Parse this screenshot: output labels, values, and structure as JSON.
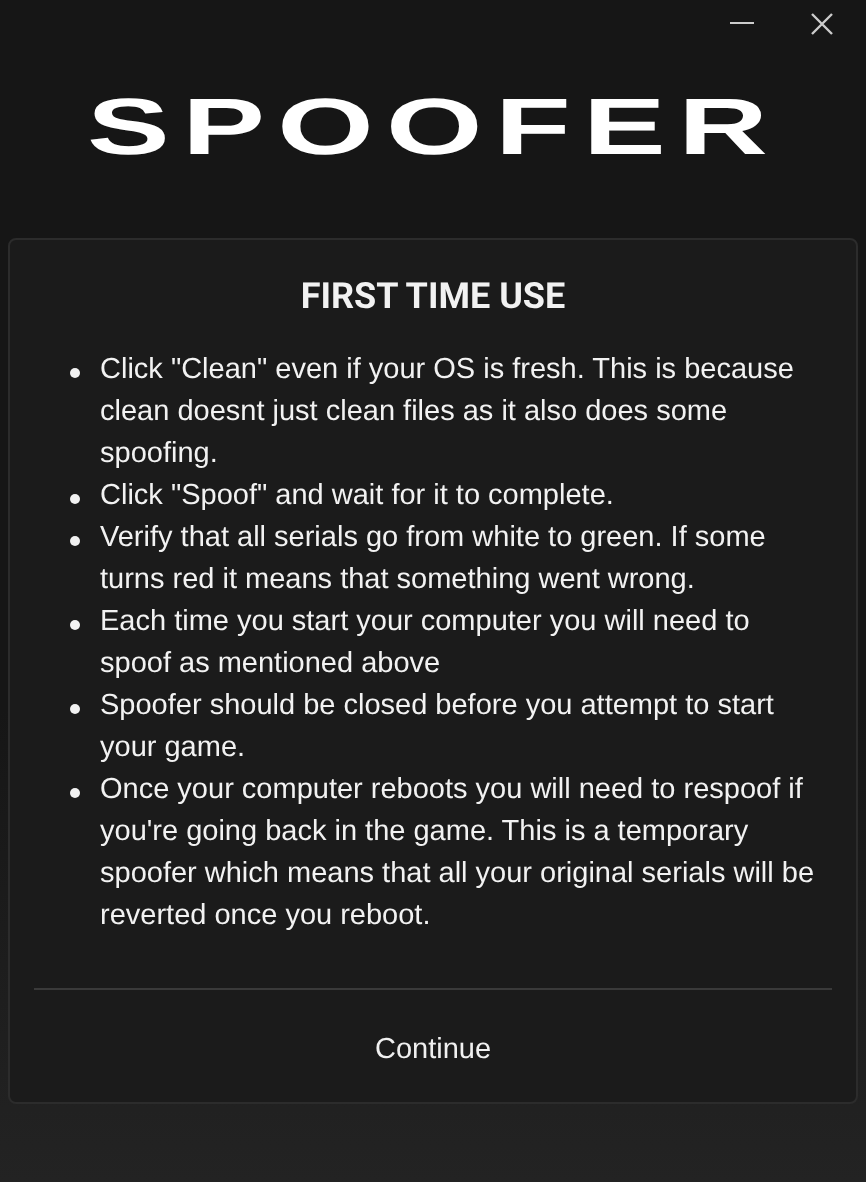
{
  "window": {
    "logo": "SPOOFER"
  },
  "dialog": {
    "title": "FIRST TIME USE",
    "items": [
      "Click \"Clean\" even if your OS is fresh. This is because clean doesnt just clean files as it also does some spoofing.",
      "Click \"Spoof\" and wait for it to complete.",
      "Verify that all serials go from white to green. If some turns red it means that something went wrong.",
      "Each time you start your computer you will need to spoof as mentioned above",
      "Spoofer should be closed before you attempt to start your game.",
      "Once your computer reboots you will need to respoof if you're going back in the game. This is a temporary spoofer which means that all your original serials will be reverted once you reboot."
    ],
    "button": "Continue"
  }
}
